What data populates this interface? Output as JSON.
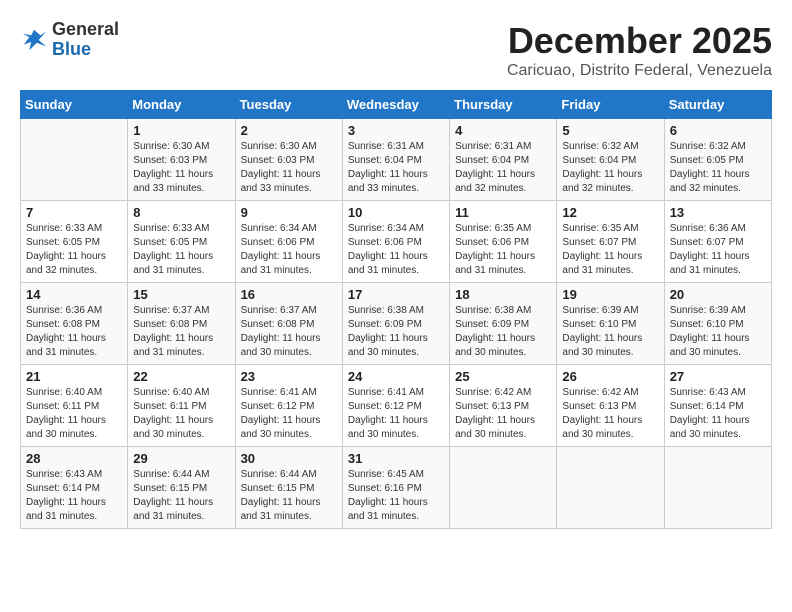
{
  "header": {
    "logo_general": "General",
    "logo_blue": "Blue",
    "title": "December 2025",
    "subtitle": "Caricuao, Distrito Federal, Venezuela"
  },
  "days_of_week": [
    "Sunday",
    "Monday",
    "Tuesday",
    "Wednesday",
    "Thursday",
    "Friday",
    "Saturday"
  ],
  "weeks": [
    [
      {
        "day": "",
        "content": ""
      },
      {
        "day": "1",
        "content": "Sunrise: 6:30 AM\nSunset: 6:03 PM\nDaylight: 11 hours\nand 33 minutes."
      },
      {
        "day": "2",
        "content": "Sunrise: 6:30 AM\nSunset: 6:03 PM\nDaylight: 11 hours\nand 33 minutes."
      },
      {
        "day": "3",
        "content": "Sunrise: 6:31 AM\nSunset: 6:04 PM\nDaylight: 11 hours\nand 33 minutes."
      },
      {
        "day": "4",
        "content": "Sunrise: 6:31 AM\nSunset: 6:04 PM\nDaylight: 11 hours\nand 32 minutes."
      },
      {
        "day": "5",
        "content": "Sunrise: 6:32 AM\nSunset: 6:04 PM\nDaylight: 11 hours\nand 32 minutes."
      },
      {
        "day": "6",
        "content": "Sunrise: 6:32 AM\nSunset: 6:05 PM\nDaylight: 11 hours\nand 32 minutes."
      }
    ],
    [
      {
        "day": "7",
        "content": "Sunrise: 6:33 AM\nSunset: 6:05 PM\nDaylight: 11 hours\nand 32 minutes."
      },
      {
        "day": "8",
        "content": "Sunrise: 6:33 AM\nSunset: 6:05 PM\nDaylight: 11 hours\nand 31 minutes."
      },
      {
        "day": "9",
        "content": "Sunrise: 6:34 AM\nSunset: 6:06 PM\nDaylight: 11 hours\nand 31 minutes."
      },
      {
        "day": "10",
        "content": "Sunrise: 6:34 AM\nSunset: 6:06 PM\nDaylight: 11 hours\nand 31 minutes."
      },
      {
        "day": "11",
        "content": "Sunrise: 6:35 AM\nSunset: 6:06 PM\nDaylight: 11 hours\nand 31 minutes."
      },
      {
        "day": "12",
        "content": "Sunrise: 6:35 AM\nSunset: 6:07 PM\nDaylight: 11 hours\nand 31 minutes."
      },
      {
        "day": "13",
        "content": "Sunrise: 6:36 AM\nSunset: 6:07 PM\nDaylight: 11 hours\nand 31 minutes."
      }
    ],
    [
      {
        "day": "14",
        "content": "Sunrise: 6:36 AM\nSunset: 6:08 PM\nDaylight: 11 hours\nand 31 minutes."
      },
      {
        "day": "15",
        "content": "Sunrise: 6:37 AM\nSunset: 6:08 PM\nDaylight: 11 hours\nand 31 minutes."
      },
      {
        "day": "16",
        "content": "Sunrise: 6:37 AM\nSunset: 6:08 PM\nDaylight: 11 hours\nand 30 minutes."
      },
      {
        "day": "17",
        "content": "Sunrise: 6:38 AM\nSunset: 6:09 PM\nDaylight: 11 hours\nand 30 minutes."
      },
      {
        "day": "18",
        "content": "Sunrise: 6:38 AM\nSunset: 6:09 PM\nDaylight: 11 hours\nand 30 minutes."
      },
      {
        "day": "19",
        "content": "Sunrise: 6:39 AM\nSunset: 6:10 PM\nDaylight: 11 hours\nand 30 minutes."
      },
      {
        "day": "20",
        "content": "Sunrise: 6:39 AM\nSunset: 6:10 PM\nDaylight: 11 hours\nand 30 minutes."
      }
    ],
    [
      {
        "day": "21",
        "content": "Sunrise: 6:40 AM\nSunset: 6:11 PM\nDaylight: 11 hours\nand 30 minutes."
      },
      {
        "day": "22",
        "content": "Sunrise: 6:40 AM\nSunset: 6:11 PM\nDaylight: 11 hours\nand 30 minutes."
      },
      {
        "day": "23",
        "content": "Sunrise: 6:41 AM\nSunset: 6:12 PM\nDaylight: 11 hours\nand 30 minutes."
      },
      {
        "day": "24",
        "content": "Sunrise: 6:41 AM\nSunset: 6:12 PM\nDaylight: 11 hours\nand 30 minutes."
      },
      {
        "day": "25",
        "content": "Sunrise: 6:42 AM\nSunset: 6:13 PM\nDaylight: 11 hours\nand 30 minutes."
      },
      {
        "day": "26",
        "content": "Sunrise: 6:42 AM\nSunset: 6:13 PM\nDaylight: 11 hours\nand 30 minutes."
      },
      {
        "day": "27",
        "content": "Sunrise: 6:43 AM\nSunset: 6:14 PM\nDaylight: 11 hours\nand 30 minutes."
      }
    ],
    [
      {
        "day": "28",
        "content": "Sunrise: 6:43 AM\nSunset: 6:14 PM\nDaylight: 11 hours\nand 31 minutes."
      },
      {
        "day": "29",
        "content": "Sunrise: 6:44 AM\nSunset: 6:15 PM\nDaylight: 11 hours\nand 31 minutes."
      },
      {
        "day": "30",
        "content": "Sunrise: 6:44 AM\nSunset: 6:15 PM\nDaylight: 11 hours\nand 31 minutes."
      },
      {
        "day": "31",
        "content": "Sunrise: 6:45 AM\nSunset: 6:16 PM\nDaylight: 11 hours\nand 31 minutes."
      },
      {
        "day": "",
        "content": ""
      },
      {
        "day": "",
        "content": ""
      },
      {
        "day": "",
        "content": ""
      }
    ]
  ]
}
